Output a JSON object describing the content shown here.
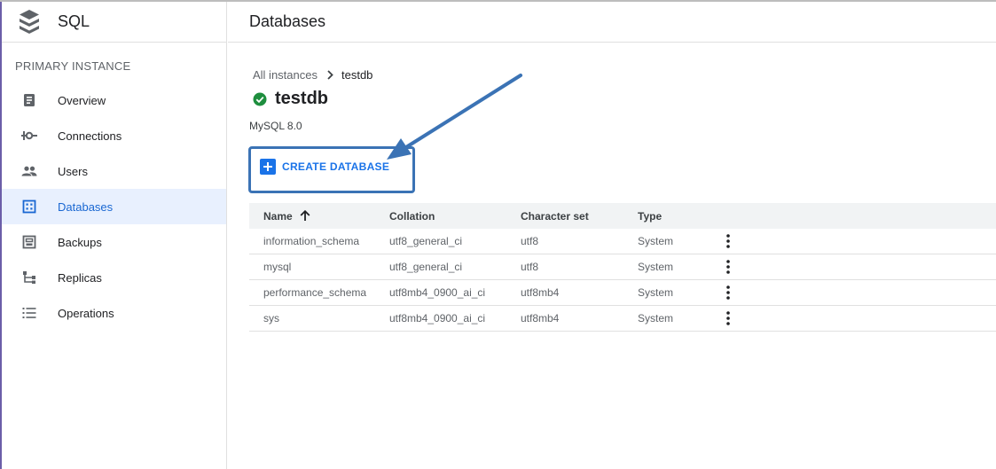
{
  "brand": {
    "title": "SQL",
    "icon": "sql-stack-icon"
  },
  "sidebar": {
    "section_label": "PRIMARY INSTANCE",
    "items": [
      {
        "label": "Overview",
        "icon": "overview-icon"
      },
      {
        "label": "Connections",
        "icon": "connections-icon"
      },
      {
        "label": "Users",
        "icon": "users-icon"
      },
      {
        "label": "Databases",
        "icon": "databases-icon",
        "active": true
      },
      {
        "label": "Backups",
        "icon": "backups-icon"
      },
      {
        "label": "Replicas",
        "icon": "replicas-icon"
      },
      {
        "label": "Operations",
        "icon": "operations-icon"
      }
    ]
  },
  "header": {
    "title": "Databases"
  },
  "breadcrumb": {
    "parent": "All instances",
    "current": "testdb"
  },
  "instance": {
    "name": "testdb",
    "version": "MySQL 8.0",
    "status": "running"
  },
  "actions": {
    "create_database": "CREATE DATABASE"
  },
  "table": {
    "columns": {
      "name": "Name",
      "collation": "Collation",
      "charset": "Character set",
      "type": "Type"
    },
    "rows": [
      {
        "name": "information_schema",
        "collation": "utf8_general_ci",
        "charset": "utf8",
        "type": "System"
      },
      {
        "name": "mysql",
        "collation": "utf8_general_ci",
        "charset": "utf8",
        "type": "System"
      },
      {
        "name": "performance_schema",
        "collation": "utf8mb4_0900_ai_ci",
        "charset": "utf8mb4",
        "type": "System"
      },
      {
        "name": "sys",
        "collation": "utf8mb4_0900_ai_ci",
        "charset": "utf8mb4",
        "type": "System"
      }
    ]
  },
  "colors": {
    "accent": "#1a73e8",
    "active_bg": "#e8f0fe",
    "status_green": "#1e8e3e",
    "annotation": "#3b73b5"
  }
}
